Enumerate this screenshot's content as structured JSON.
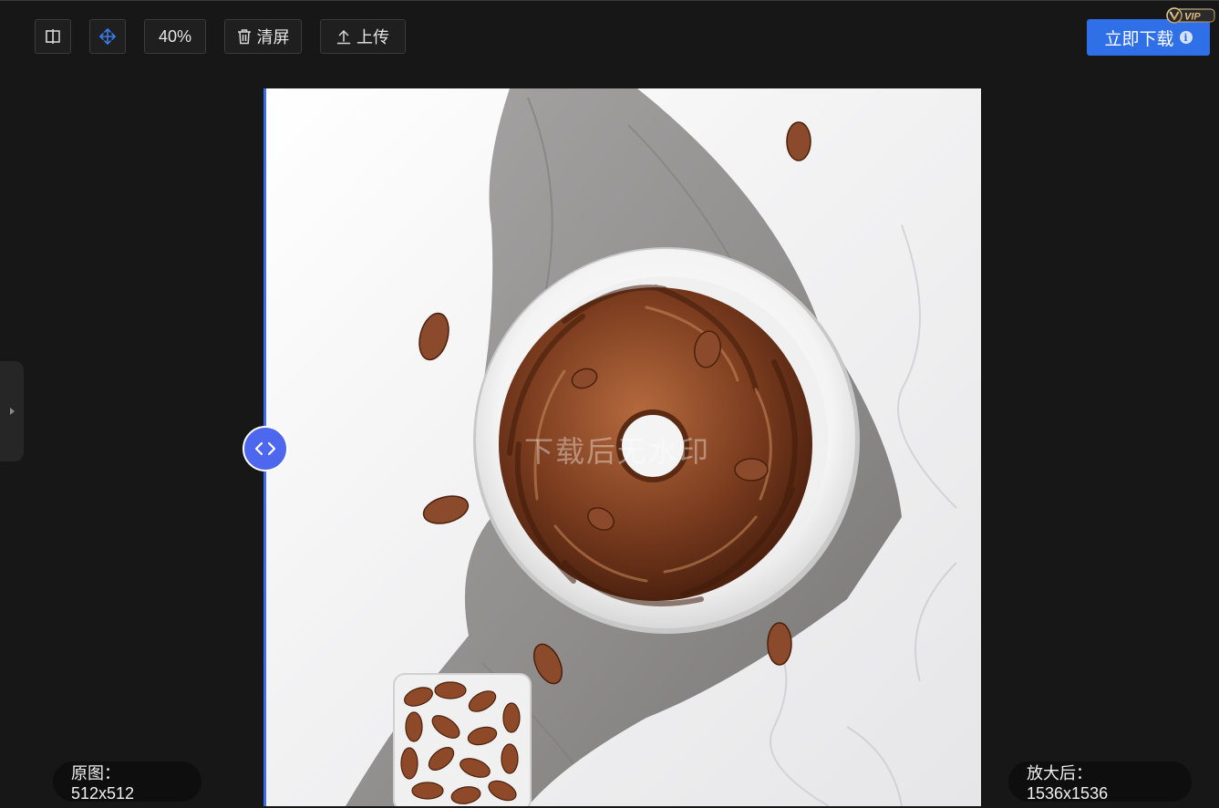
{
  "toolbar": {
    "zoom_label": "40%",
    "clear_label": "清屏",
    "upload_label": "上传",
    "download_label": "立即下载",
    "vip_label": "VIP"
  },
  "image": {
    "watermark": "下载后无水印",
    "original_size": "原图：512x512",
    "upscaled_size": "放大后：1536x1536"
  },
  "icons": {
    "compare": "split-view-icon",
    "move": "move-arrows-icon",
    "clear": "trash-icon",
    "upload": "upload-icon",
    "info": "info-icon",
    "side": "caret-right-icon",
    "handle": "chevron-left-right-icon"
  },
  "colors": {
    "background": "#171717",
    "accent": "#2f6fe8",
    "handle": "#4d68ef"
  }
}
